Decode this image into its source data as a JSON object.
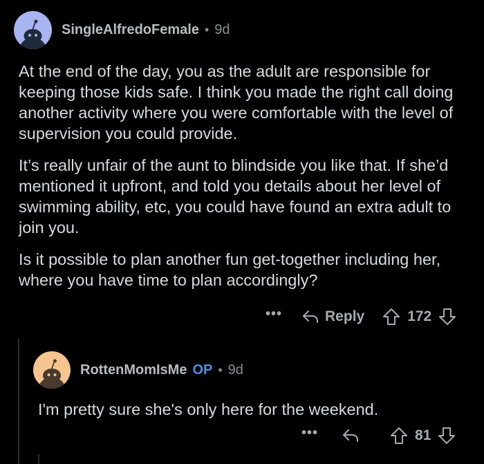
{
  "comments": [
    {
      "username": "SingleAlfredoFemale",
      "separator": "•",
      "age": "9d",
      "paragraphs": [
        "At the end of the day, you as the adult are responsible for keeping those kids safe.  I think you made the right call doing another activity where you were comfortable with the level of supervision you could provide.",
        "It’s really unfair of the aunt to blindside you like that.  If she’d mentioned it upfront, and told you details about her level of swimming ability, etc, you could have found an extra adult to join you.",
        "Is it possible to plan another fun get-together including her, where you have time to plan accordingly?"
      ],
      "more_label": "•••",
      "reply_label": "Reply",
      "votes": "172",
      "avatar_color": "#a9b5f0"
    },
    {
      "username": "RottenMomIsMe",
      "op_label": "OP",
      "separator": "•",
      "age": "9d",
      "paragraphs": [
        "I'm pretty sure she's only here for the weekend."
      ],
      "more_label": "•••",
      "votes": "81",
      "avatar_color": "#f6c48e"
    }
  ],
  "colors": {
    "background": "#000000",
    "text": "#d7dadc",
    "meta": "#8a8d90",
    "op_badge": "#4a8fe0",
    "thread_line": "#2a2c2e"
  },
  "icons": {
    "reply": "reply-arrow-icon",
    "upvote": "upvote-arrow-icon",
    "downvote": "downvote-arrow-icon",
    "avatar": "snoo-avatar-icon"
  }
}
